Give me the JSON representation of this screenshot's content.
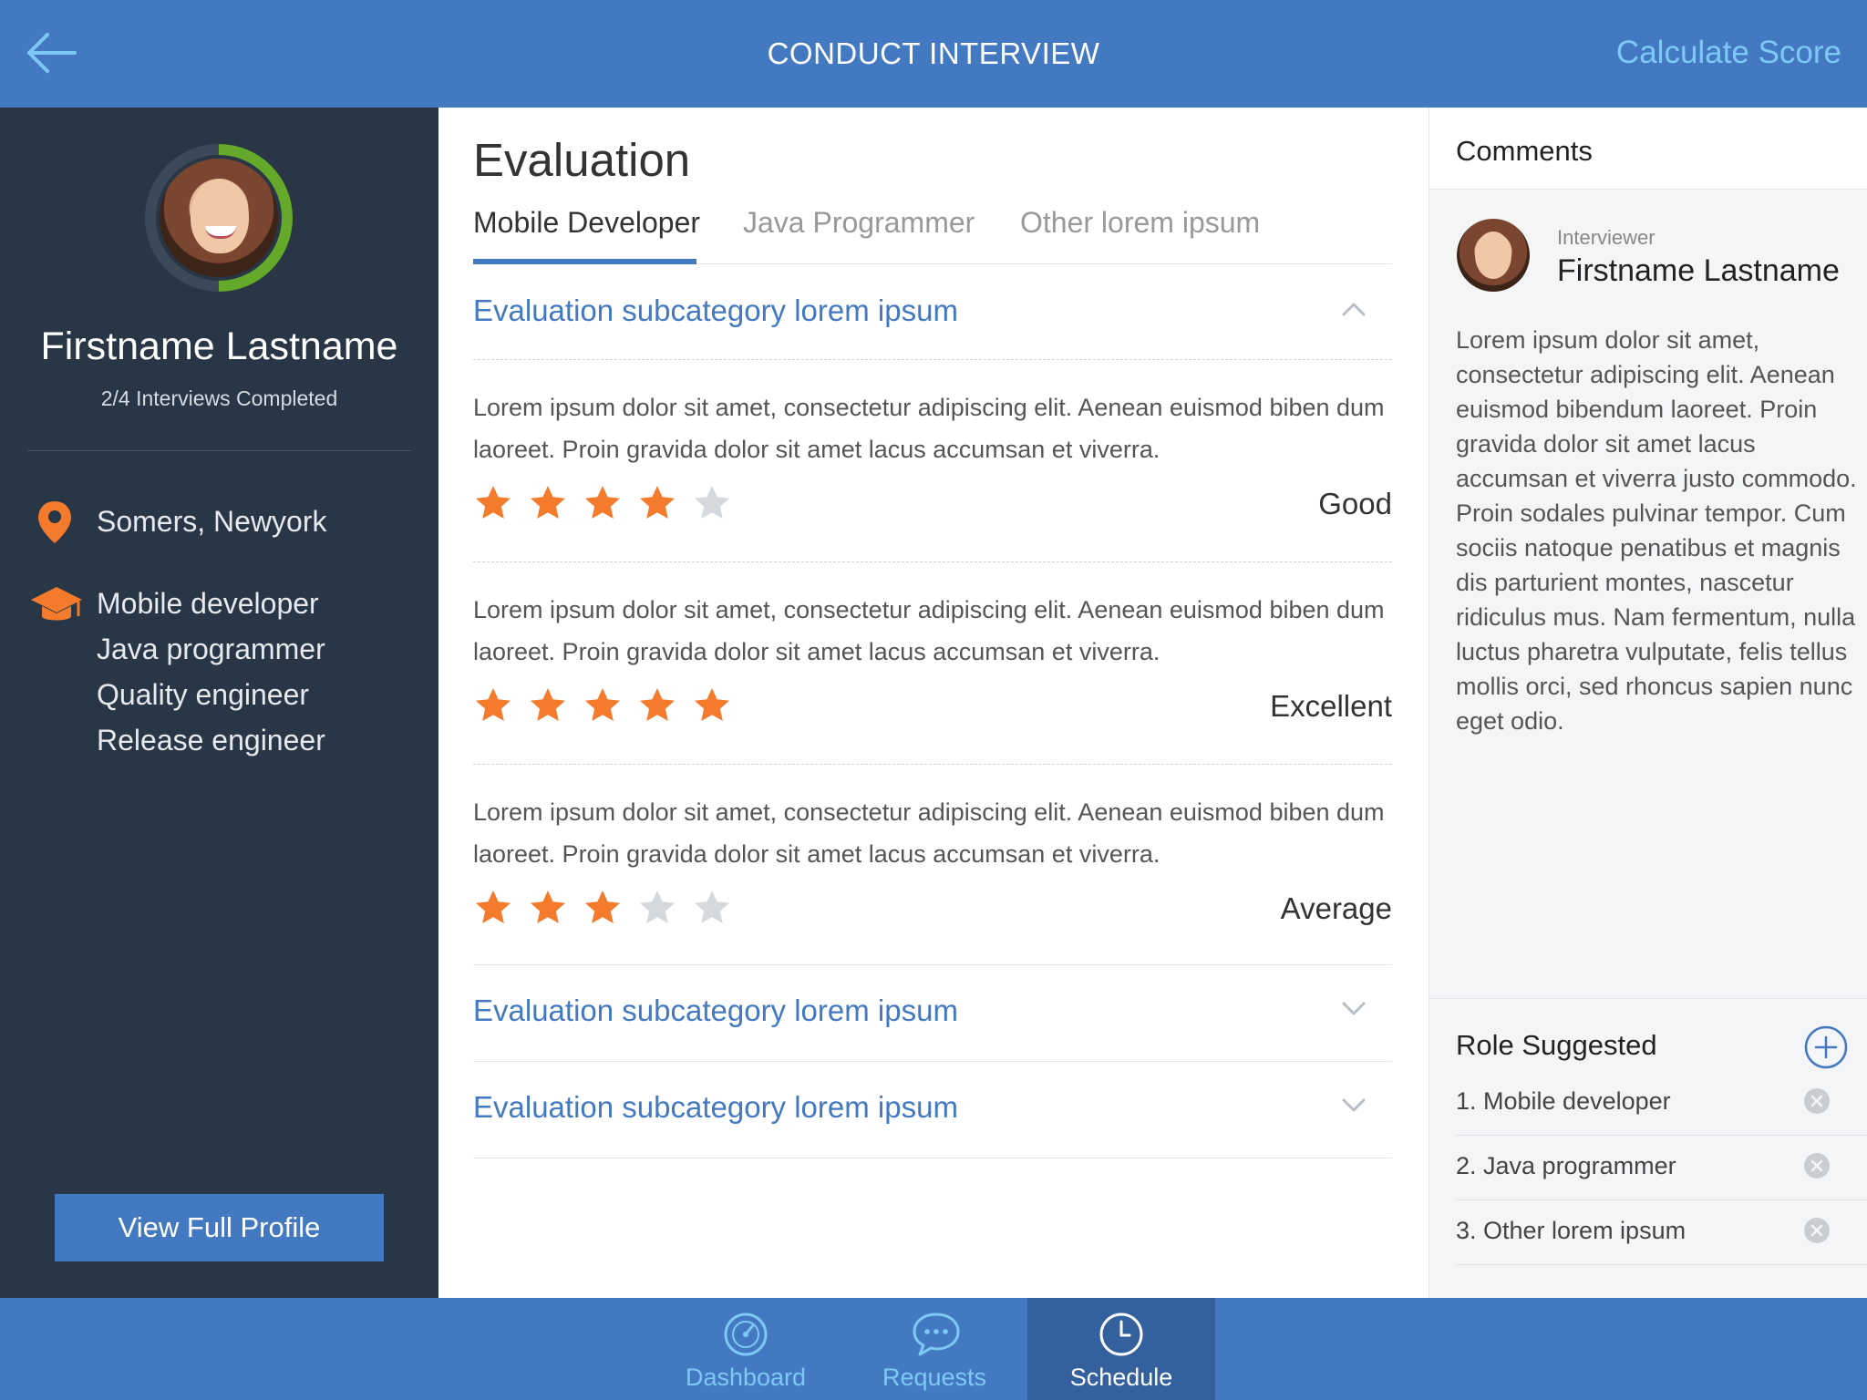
{
  "header": {
    "title": "CONDUCT INTERVIEW",
    "action_label": "Calculate Score"
  },
  "candidate": {
    "name": "Firstname Lastname",
    "progress": "2/4 Interviews Completed",
    "location": "Somers, Newyork",
    "roles": [
      "Mobile developer",
      "Java programmer",
      "Quality engineer",
      "Release engineer"
    ],
    "view_profile_label": "View Full Profile"
  },
  "evaluation": {
    "title": "Evaluation",
    "tabs": [
      {
        "label": "Mobile Developer",
        "active": true
      },
      {
        "label": "Java Programmer",
        "active": false
      },
      {
        "label": "Other lorem ipsum",
        "active": false
      }
    ],
    "subcategories": [
      {
        "title": "Evaluation subcategory lorem ipsum",
        "expanded": true,
        "criteria": [
          {
            "text": "Lorem ipsum dolor sit amet, consectetur adipiscing elit. Aenean euismod biben dum laoreet. Proin gravida dolor sit amet lacus accumsan et viverra.",
            "rating": 4,
            "max": 5,
            "label": "Good"
          },
          {
            "text": "Lorem ipsum dolor sit amet, consectetur adipiscing elit. Aenean euismod biben dum laoreet. Proin gravida dolor sit amet lacus accumsan et viverra.",
            "rating": 5,
            "max": 5,
            "label": "Excellent"
          },
          {
            "text": "Lorem ipsum dolor sit amet, consectetur adipiscing elit. Aenean euismod biben dum laoreet. Proin gravida dolor sit amet lacus accumsan et viverra.",
            "rating": 3,
            "max": 5,
            "label": "Average"
          }
        ]
      },
      {
        "title": "Evaluation subcategory lorem ipsum",
        "expanded": false
      },
      {
        "title": "Evaluation subcategory lorem ipsum",
        "expanded": false
      }
    ]
  },
  "comments": {
    "title": "Comments",
    "interviewer_label": "Interviewer",
    "interviewer_name": "Firstname Lastname",
    "body": "Lorem ipsum dolor sit amet, consectetur adipiscing elit. Aenean euismod bibendum laoreet. Proin gravida dolor sit amet lacus accumsan et viverra justo commodo. Proin sodales pulvinar tempor. Cum sociis natoque penatibus et magnis dis parturient montes, nascetur ridiculus mus. Nam fermentum, nulla luctus pharetra vulputate, felis tellus mollis orci, sed rhoncus sapien nunc eget odio."
  },
  "role_suggested": {
    "title": "Role Suggested",
    "items": [
      "1. Mobile developer",
      "2. Java programmer",
      "3. Other lorem ipsum"
    ]
  },
  "nav": {
    "tabs": [
      {
        "label": "Dashboard",
        "icon": "dashboard-icon",
        "active": false
      },
      {
        "label": "Requests",
        "icon": "chat-bubble-icon",
        "active": false
      },
      {
        "label": "Schedule",
        "icon": "clock-icon",
        "active": true
      }
    ]
  },
  "colors": {
    "brand_blue": "#4379c0",
    "sidebar_dark": "#283645",
    "star_active": "#f47a2c",
    "star_inactive": "#d5d9dd",
    "accent_light_blue": "#7ec8f7",
    "progress_green": "#64a92a"
  }
}
